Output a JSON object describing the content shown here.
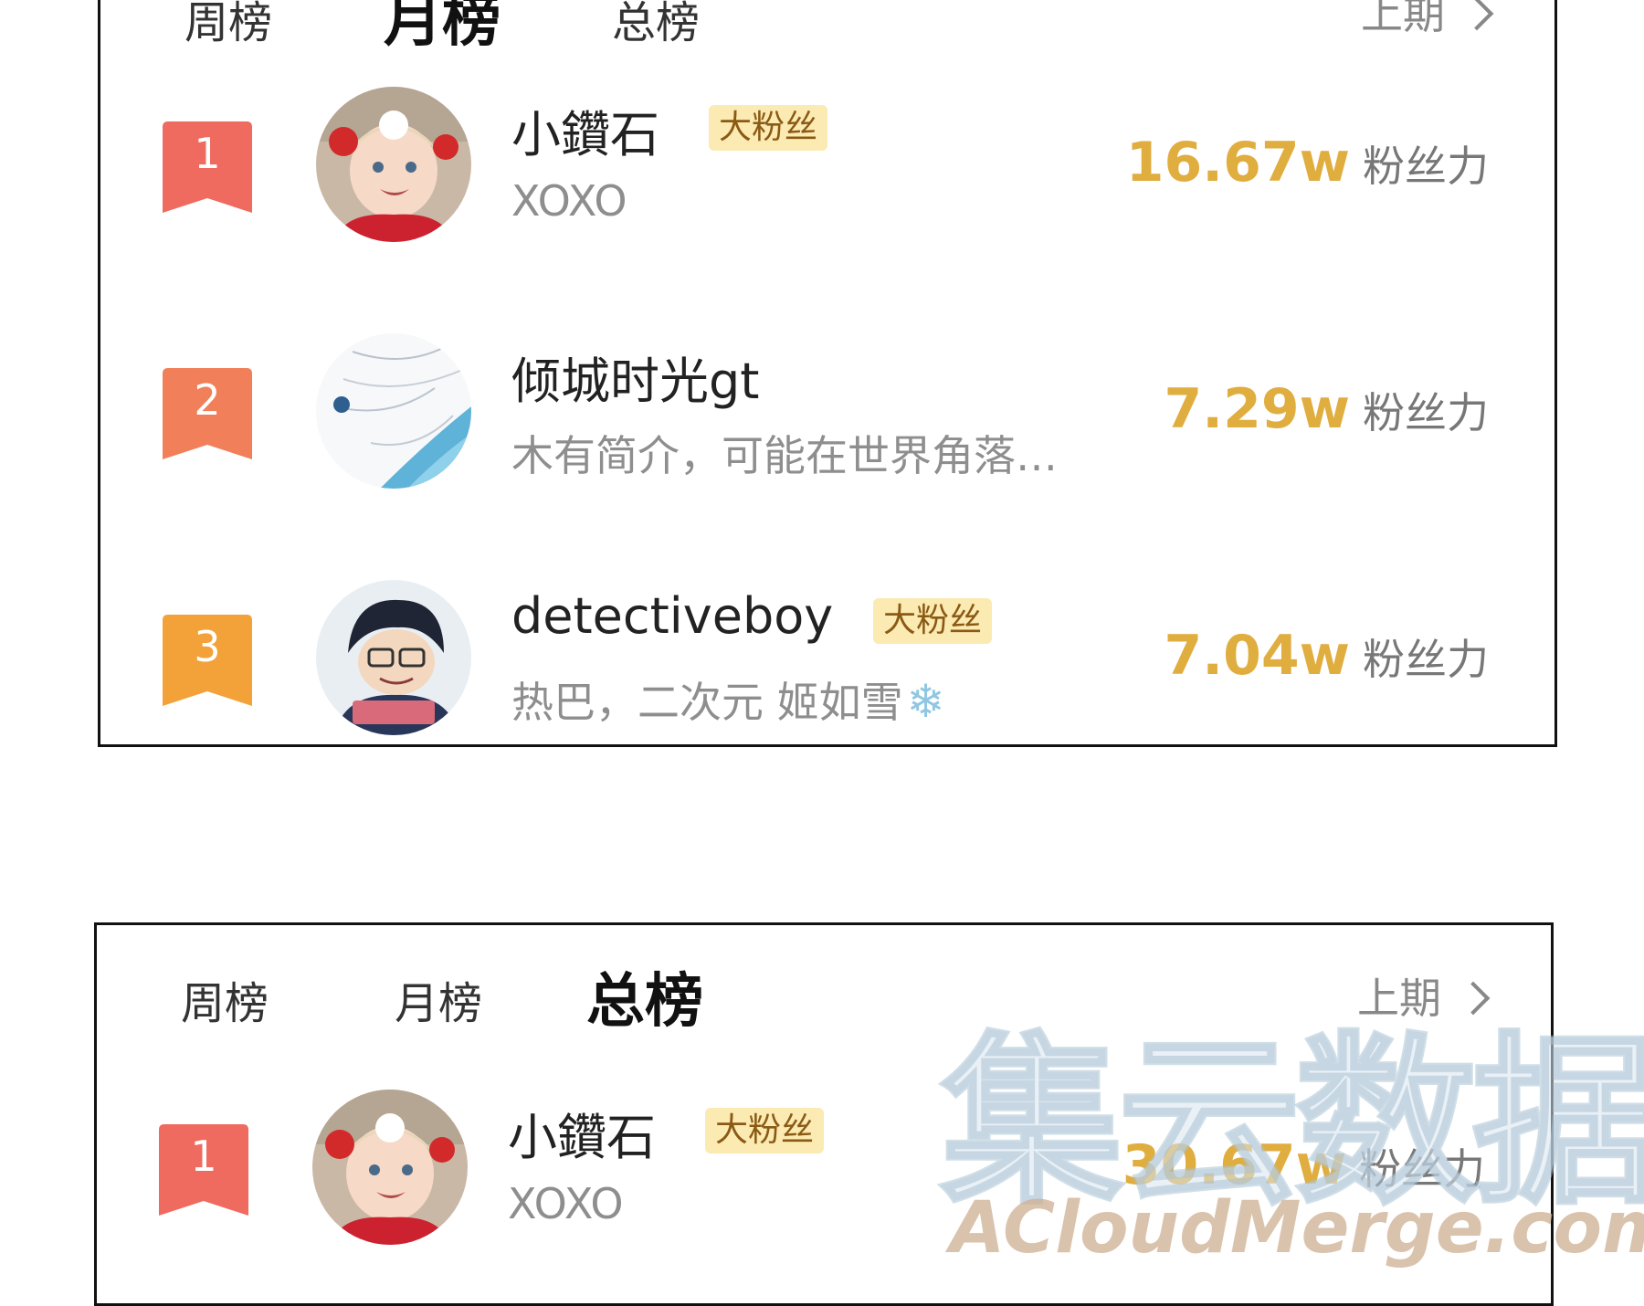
{
  "panel_top": {
    "tabs": [
      {
        "label": "周榜",
        "active": false
      },
      {
        "label": "月榜",
        "active": true
      },
      {
        "label": "总榜",
        "active": false
      }
    ],
    "prev_label": "上期",
    "entries": [
      {
        "rank": "1",
        "rank_color": "#ef6a5f",
        "name": "小鑽石",
        "badge": "大粉丝",
        "bio": "XOXO",
        "power": "16.67w",
        "power_unit": "粉丝力"
      },
      {
        "rank": "2",
        "rank_color": "#f1805a",
        "name": "倾城时光gt",
        "badge": "",
        "bio": "木有简介，可能在世界角落…",
        "power": "7.29w",
        "power_unit": "粉丝力"
      },
      {
        "rank": "3",
        "rank_color": "#f3a23a",
        "name": "detectiveboy",
        "badge": "大粉丝",
        "bio": "热巴，二次元 姬如雪",
        "bio_icon": "snowflake-icon",
        "power": "7.04w",
        "power_unit": "粉丝力"
      }
    ]
  },
  "panel_bottom": {
    "tabs": [
      {
        "label": "周榜",
        "active": false
      },
      {
        "label": "月榜",
        "active": false
      },
      {
        "label": "总榜",
        "active": true
      }
    ],
    "prev_label": "上期",
    "entries": [
      {
        "rank": "1",
        "rank_color": "#ef6a5f",
        "name": "小鑽石",
        "badge": "大粉丝",
        "bio": "XOXO",
        "power": "30.67w",
        "power_unit": "粉丝力"
      }
    ]
  },
  "watermark": {
    "cn": "集云数据",
    "en": "ACloudMerge.com"
  }
}
